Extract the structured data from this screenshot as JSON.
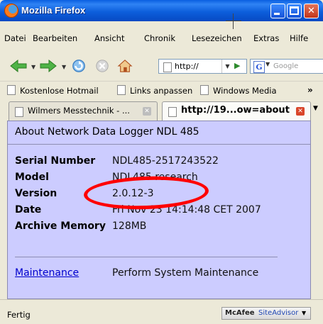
{
  "window": {
    "title": "Mozilla Firefox",
    "controls": {
      "minimize": "",
      "maximize": "",
      "close": "✕"
    }
  },
  "menu": [
    "Datei",
    "Bearbeiten",
    "Ansicht",
    "Chronik",
    "Lesezeichen",
    "Extras",
    "Hilfe"
  ],
  "toolbar": {
    "back_icon": "back-arrow-icon",
    "forward_icon": "forward-arrow-icon",
    "reload_icon": "reload-icon",
    "stop_icon": "stop-icon",
    "home_icon": "home-icon",
    "url": "http://",
    "search_engine_icon": "G",
    "search_placeholder": "Google"
  },
  "bookmarks": [
    "Kostenlose Hotmail",
    "Links anpassen",
    "Windows Media"
  ],
  "bookmarks_overflow": "»",
  "tabs": [
    {
      "label": "Wilmers Messtechnik - ...",
      "active": false
    },
    {
      "label": "http://19...ow=about",
      "active": true
    }
  ],
  "page": {
    "title": "About Network Data Logger NDL 485",
    "fields": [
      {
        "key": "Serial Number",
        "value": "NDL485-2517243522"
      },
      {
        "key": "Model",
        "value": "NDL485 research"
      },
      {
        "key": "Version",
        "value": "2.0.12-3"
      },
      {
        "key": "Date",
        "value": "Fri Nov 23 14:14:48 CET 2007"
      },
      {
        "key": "Archive Memory",
        "value": "128MB"
      }
    ],
    "maintenance_link": "Maintenance",
    "maintenance_desc": "Perform System Maintenance"
  },
  "status": {
    "text": "Fertig",
    "mcafee_brand": "McAfee",
    "mcafee_product": "SiteAdvisor"
  },
  "colors": {
    "titlebar": "#0b5bd8",
    "content_bg": "#ccccff",
    "annotation": "#ff0000",
    "link": "#0000cc"
  }
}
